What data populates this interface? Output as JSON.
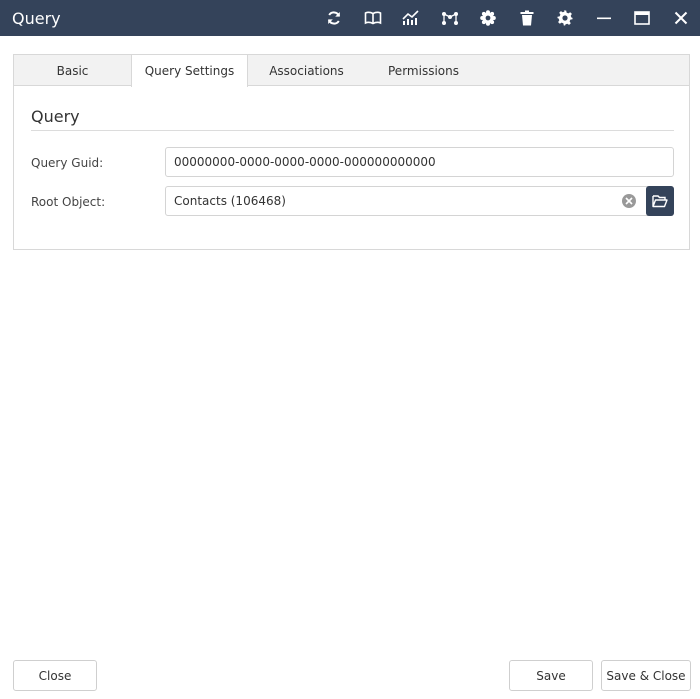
{
  "window": {
    "title": "Query",
    "toolbar_icons": [
      "refresh-icon",
      "book-icon",
      "chart-icon",
      "network-icon",
      "cog-flower-icon",
      "trash-icon",
      "gear-icon",
      "minimize-icon",
      "maximize-icon",
      "close-icon"
    ]
  },
  "tabs": [
    {
      "label": "Basic",
      "active": false
    },
    {
      "label": "Query Settings",
      "active": true
    },
    {
      "label": "Associations",
      "active": false
    },
    {
      "label": "Permissions",
      "active": false
    }
  ],
  "section": {
    "title": "Query"
  },
  "fields": {
    "query_guid": {
      "label": "Query Guid:",
      "value": "00000000-0000-0000-0000-000000000000"
    },
    "root_object": {
      "label": "Root Object:",
      "value": "Contacts (106468)"
    }
  },
  "footer": {
    "close_label": "Close",
    "save_label": "Save",
    "save_close_label": "Save & Close"
  },
  "colors": {
    "titlebar": "#34435a",
    "accent": "#34435a"
  }
}
